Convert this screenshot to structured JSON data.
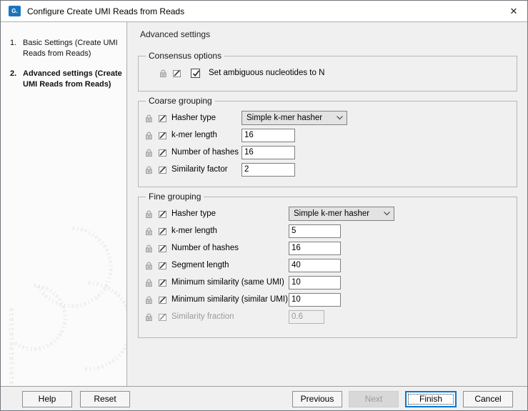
{
  "window": {
    "title": "Configure Create UMI Reads from Reads",
    "app_icon_text": "G.",
    "close_glyph": "✕"
  },
  "sidebar": {
    "steps": [
      {
        "number": "1.",
        "label": "Basic Settings (Create UMI Reads from Reads)",
        "current": false
      },
      {
        "number": "2.",
        "label": "Advanced settings (Create UMI Reads from Reads)",
        "current": true
      }
    ]
  },
  "content": {
    "header": "Advanced settings",
    "groups": {
      "consensus": {
        "title": "Consensus options",
        "checkbox": {
          "label": "Set ambiguous nucleotides to N",
          "checked": true,
          "checked_attr": "checked"
        }
      },
      "coarse": {
        "title": "Coarse grouping",
        "rows": [
          {
            "label": "Hasher type",
            "control": "select",
            "value": "Simple k-mer hasher"
          },
          {
            "label": "k-mer length",
            "control": "input",
            "value": "16"
          },
          {
            "label": "Number of hashes",
            "control": "input",
            "value": "16"
          },
          {
            "label": "Similarity factor",
            "control": "input",
            "value": "2"
          }
        ]
      },
      "fine": {
        "title": "Fine grouping",
        "rows": [
          {
            "label": "Hasher type",
            "control": "select",
            "value": "Simple k-mer hasher"
          },
          {
            "label": "k-mer length",
            "control": "input",
            "value": "5"
          },
          {
            "label": "Number of hashes",
            "control": "input",
            "value": "16"
          },
          {
            "label": "Segment length",
            "control": "input",
            "value": "40"
          },
          {
            "label": "Minimum similarity (same UMI)",
            "control": "input",
            "value": "10"
          },
          {
            "label": "Minimum similarity (similar UMI)",
            "control": "input",
            "value": "10"
          },
          {
            "label": "Similarity fraction",
            "control": "input",
            "value": "0.6",
            "disabled": true
          }
        ]
      }
    }
  },
  "footer": {
    "help": "Help",
    "reset": "Reset",
    "previous": "Previous",
    "next": "Next",
    "finish": "Finish",
    "cancel": "Cancel",
    "next_disabled": true,
    "finish_focused": true
  },
  "icons": {
    "lock": "lock-icon",
    "edit": "edit-pencil-icon",
    "chevron": "chevron-down-icon",
    "close": "close-icon"
  },
  "watermark": {
    "ring1": "0100110010011010011001001101001100110010",
    "ring2": "01001100100110100110010011010",
    "ring3": "0101101001001100101101001100100110",
    "column": "0101101001011010"
  },
  "colors": {
    "accent": "#0078d7",
    "app_icon_bg": "#1c75bc",
    "titlebar_bg": "#ffffff",
    "dialog_bg": "#f0f0f0",
    "sidebar_bg": "#fbfbfb",
    "disabled_text": "#9a9a9a"
  }
}
